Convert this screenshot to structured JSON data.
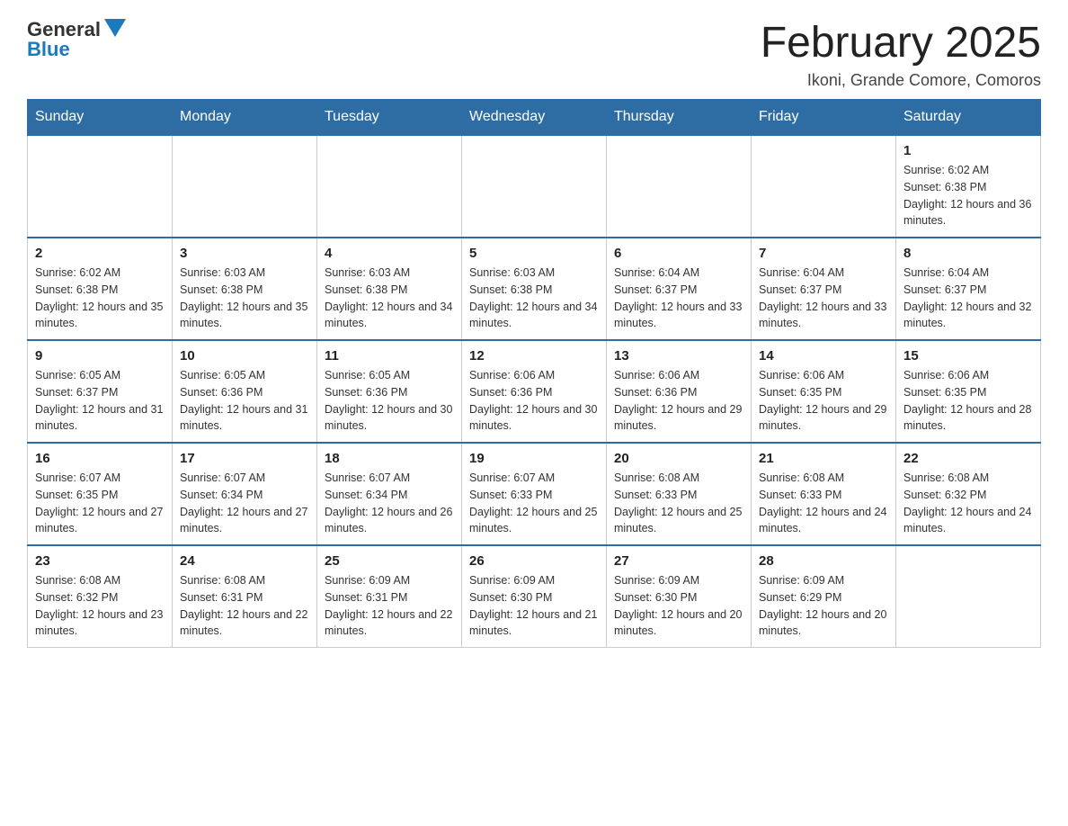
{
  "logo": {
    "general": "General",
    "blue": "Blue"
  },
  "title": {
    "month_year": "February 2025",
    "location": "Ikoni, Grande Comore, Comoros"
  },
  "weekdays": [
    "Sunday",
    "Monday",
    "Tuesday",
    "Wednesday",
    "Thursday",
    "Friday",
    "Saturday"
  ],
  "weeks": [
    [
      {
        "day": "",
        "info": ""
      },
      {
        "day": "",
        "info": ""
      },
      {
        "day": "",
        "info": ""
      },
      {
        "day": "",
        "info": ""
      },
      {
        "day": "",
        "info": ""
      },
      {
        "day": "",
        "info": ""
      },
      {
        "day": "1",
        "info": "Sunrise: 6:02 AM\nSunset: 6:38 PM\nDaylight: 12 hours and 36 minutes."
      }
    ],
    [
      {
        "day": "2",
        "info": "Sunrise: 6:02 AM\nSunset: 6:38 PM\nDaylight: 12 hours and 35 minutes."
      },
      {
        "day": "3",
        "info": "Sunrise: 6:03 AM\nSunset: 6:38 PM\nDaylight: 12 hours and 35 minutes."
      },
      {
        "day": "4",
        "info": "Sunrise: 6:03 AM\nSunset: 6:38 PM\nDaylight: 12 hours and 34 minutes."
      },
      {
        "day": "5",
        "info": "Sunrise: 6:03 AM\nSunset: 6:38 PM\nDaylight: 12 hours and 34 minutes."
      },
      {
        "day": "6",
        "info": "Sunrise: 6:04 AM\nSunset: 6:37 PM\nDaylight: 12 hours and 33 minutes."
      },
      {
        "day": "7",
        "info": "Sunrise: 6:04 AM\nSunset: 6:37 PM\nDaylight: 12 hours and 33 minutes."
      },
      {
        "day": "8",
        "info": "Sunrise: 6:04 AM\nSunset: 6:37 PM\nDaylight: 12 hours and 32 minutes."
      }
    ],
    [
      {
        "day": "9",
        "info": "Sunrise: 6:05 AM\nSunset: 6:37 PM\nDaylight: 12 hours and 31 minutes."
      },
      {
        "day": "10",
        "info": "Sunrise: 6:05 AM\nSunset: 6:36 PM\nDaylight: 12 hours and 31 minutes."
      },
      {
        "day": "11",
        "info": "Sunrise: 6:05 AM\nSunset: 6:36 PM\nDaylight: 12 hours and 30 minutes."
      },
      {
        "day": "12",
        "info": "Sunrise: 6:06 AM\nSunset: 6:36 PM\nDaylight: 12 hours and 30 minutes."
      },
      {
        "day": "13",
        "info": "Sunrise: 6:06 AM\nSunset: 6:36 PM\nDaylight: 12 hours and 29 minutes."
      },
      {
        "day": "14",
        "info": "Sunrise: 6:06 AM\nSunset: 6:35 PM\nDaylight: 12 hours and 29 minutes."
      },
      {
        "day": "15",
        "info": "Sunrise: 6:06 AM\nSunset: 6:35 PM\nDaylight: 12 hours and 28 minutes."
      }
    ],
    [
      {
        "day": "16",
        "info": "Sunrise: 6:07 AM\nSunset: 6:35 PM\nDaylight: 12 hours and 27 minutes."
      },
      {
        "day": "17",
        "info": "Sunrise: 6:07 AM\nSunset: 6:34 PM\nDaylight: 12 hours and 27 minutes."
      },
      {
        "day": "18",
        "info": "Sunrise: 6:07 AM\nSunset: 6:34 PM\nDaylight: 12 hours and 26 minutes."
      },
      {
        "day": "19",
        "info": "Sunrise: 6:07 AM\nSunset: 6:33 PM\nDaylight: 12 hours and 25 minutes."
      },
      {
        "day": "20",
        "info": "Sunrise: 6:08 AM\nSunset: 6:33 PM\nDaylight: 12 hours and 25 minutes."
      },
      {
        "day": "21",
        "info": "Sunrise: 6:08 AM\nSunset: 6:33 PM\nDaylight: 12 hours and 24 minutes."
      },
      {
        "day": "22",
        "info": "Sunrise: 6:08 AM\nSunset: 6:32 PM\nDaylight: 12 hours and 24 minutes."
      }
    ],
    [
      {
        "day": "23",
        "info": "Sunrise: 6:08 AM\nSunset: 6:32 PM\nDaylight: 12 hours and 23 minutes."
      },
      {
        "day": "24",
        "info": "Sunrise: 6:08 AM\nSunset: 6:31 PM\nDaylight: 12 hours and 22 minutes."
      },
      {
        "day": "25",
        "info": "Sunrise: 6:09 AM\nSunset: 6:31 PM\nDaylight: 12 hours and 22 minutes."
      },
      {
        "day": "26",
        "info": "Sunrise: 6:09 AM\nSunset: 6:30 PM\nDaylight: 12 hours and 21 minutes."
      },
      {
        "day": "27",
        "info": "Sunrise: 6:09 AM\nSunset: 6:30 PM\nDaylight: 12 hours and 20 minutes."
      },
      {
        "day": "28",
        "info": "Sunrise: 6:09 AM\nSunset: 6:29 PM\nDaylight: 12 hours and 20 minutes."
      },
      {
        "day": "",
        "info": ""
      }
    ]
  ]
}
